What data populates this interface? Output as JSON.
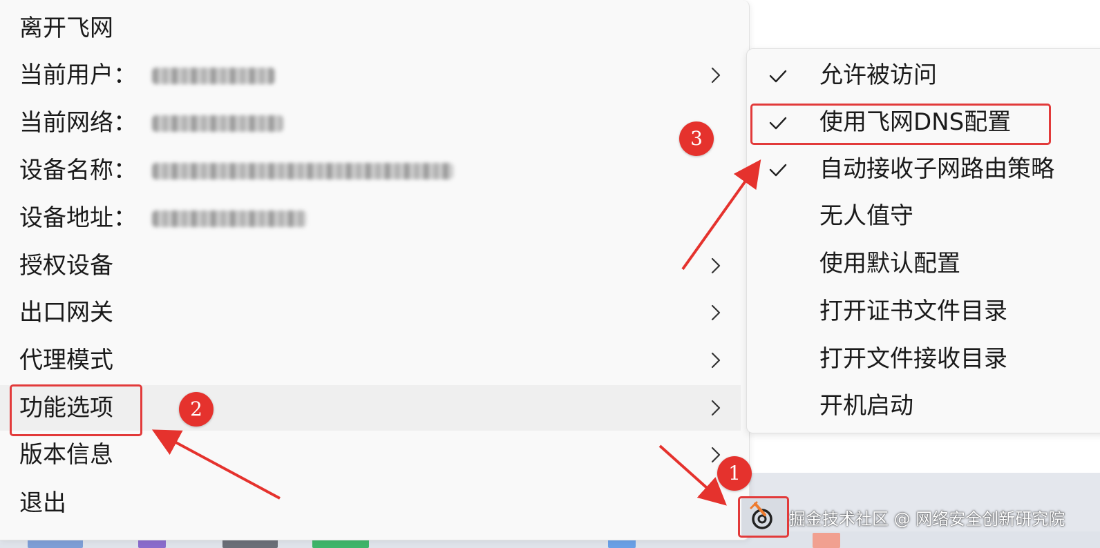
{
  "main_menu": {
    "items": [
      {
        "label": "离开飞网",
        "has_submenu": false
      },
      {
        "label": "当前用户：",
        "redacted_value": true,
        "has_submenu": true
      },
      {
        "label": "当前网络：",
        "redacted_value": true,
        "has_submenu": false
      },
      {
        "label": "设备名称：",
        "redacted_value": true,
        "has_submenu": false
      },
      {
        "label": "设备地址：",
        "redacted_value": true,
        "has_submenu": false
      },
      {
        "label": "授权设备",
        "has_submenu": true
      },
      {
        "label": "出口网关",
        "has_submenu": true
      },
      {
        "label": "代理模式",
        "has_submenu": true
      },
      {
        "label": "功能选项",
        "has_submenu": true,
        "highlighted": true
      },
      {
        "label": "版本信息",
        "has_submenu": true
      },
      {
        "label": "退出",
        "has_submenu": false
      }
    ]
  },
  "sub_menu": {
    "items": [
      {
        "label": "允许被访问",
        "checked": true
      },
      {
        "label": "使用飞网DNS配置",
        "checked": true
      },
      {
        "label": "自动接收子网路由策略",
        "checked": true
      },
      {
        "label": "无人值守",
        "checked": false
      },
      {
        "label": "使用默认配置",
        "checked": false
      },
      {
        "label": "打开证书文件目录",
        "checked": false
      },
      {
        "label": "打开文件接收目录",
        "checked": false
      },
      {
        "label": "开机启动",
        "checked": false
      }
    ]
  },
  "annotations": {
    "step1": "1",
    "step2": "2",
    "step3": "3",
    "color": "#e5322d"
  },
  "tray": {
    "icon": "feiwang-tray-icon"
  },
  "watermark": "掘金技术社区 @ 网络安全创新研究院",
  "colors": {
    "menu_bg": "#f9f9f9",
    "highlight_bg": "#efefef",
    "accent_red": "#e23a3a"
  }
}
